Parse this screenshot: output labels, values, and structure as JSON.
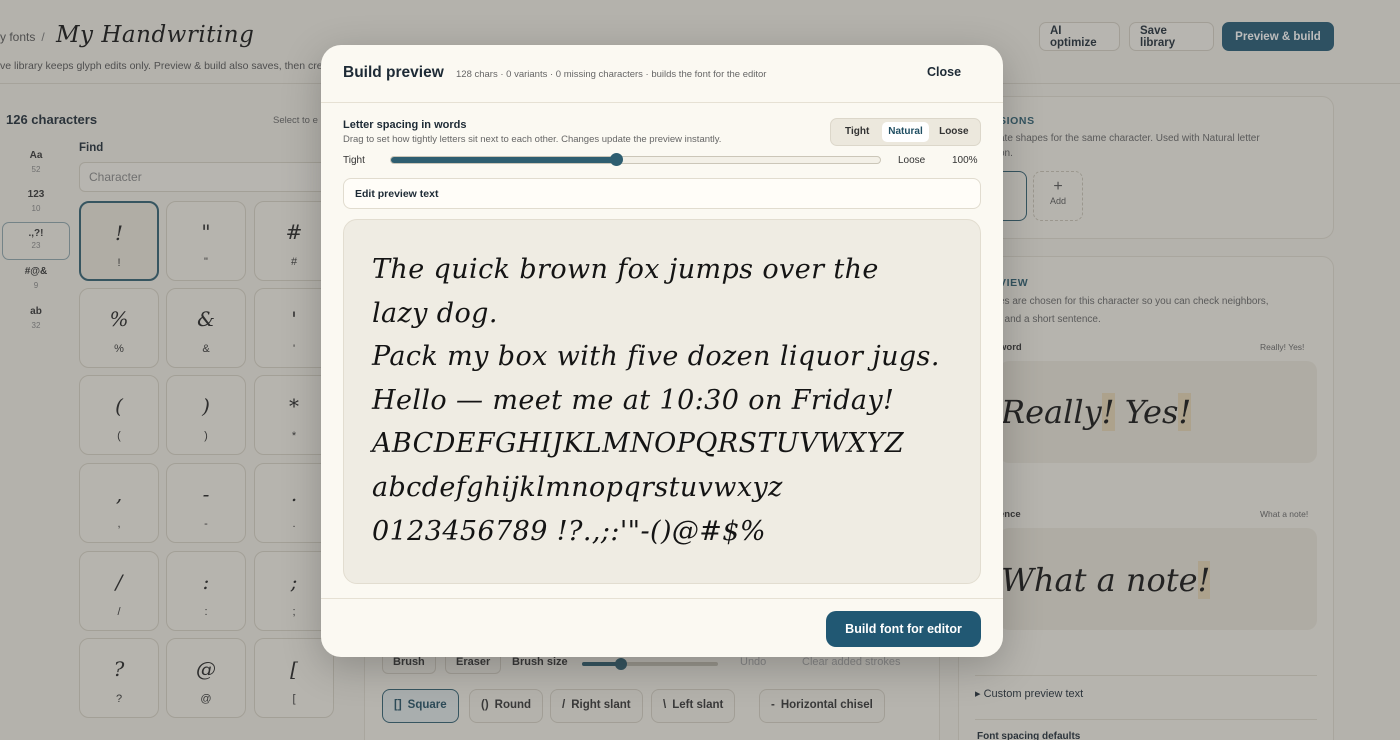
{
  "header": {
    "breadcrumb_parent": "y fonts",
    "breadcrumb_sep": "/",
    "font_name": "My Handwriting",
    "subline": "ve library keeps glyph edits only. Preview & build also saves, then cre",
    "ai_optimize": "AI optimize",
    "save_library": "Save library",
    "preview_build": "Preview & build"
  },
  "left": {
    "char_count": "126 characters",
    "select_hint": "Select to e",
    "find_label": "Find",
    "find_placeholder": "Character",
    "categories": [
      {
        "label": "Aa",
        "count": "52"
      },
      {
        "label": "123",
        "count": "10"
      },
      {
        "label": ".,?!",
        "count": "23"
      },
      {
        "label": "#@&",
        "count": "9"
      },
      {
        "label": "ab",
        "count": "32"
      }
    ],
    "tiles": [
      {
        "glyph": "!",
        "label": "!"
      },
      {
        "glyph": "\"",
        "label": "\""
      },
      {
        "glyph": "#",
        "label": "#"
      },
      {
        "glyph": "%",
        "label": "%"
      },
      {
        "glyph": "&",
        "label": "&"
      },
      {
        "glyph": "'",
        "label": "'"
      },
      {
        "glyph": "(",
        "label": "("
      },
      {
        "glyph": ")",
        "label": ")"
      },
      {
        "glyph": "*",
        "label": "*"
      },
      {
        "glyph": ",",
        "label": ","
      },
      {
        "glyph": "-",
        "label": "-"
      },
      {
        "glyph": ".",
        "label": "."
      },
      {
        "glyph": "/",
        "label": "/"
      },
      {
        "glyph": ":",
        "label": ":"
      },
      {
        "glyph": ";",
        "label": ";"
      },
      {
        "glyph": "?",
        "label": "?"
      },
      {
        "glyph": "@",
        "label": "@"
      },
      {
        "glyph": "[",
        "label": "["
      }
    ]
  },
  "right": {
    "variants_title": "SIONS",
    "variants_desc_1": "ate shapes for the same character. Used with Natural letter",
    "variants_desc_2": "on.",
    "add_label": "Add",
    "add_plus": "+",
    "preview_title": "VIEW",
    "preview_desc_1": "es are chosen for this character so you can check neighbors,",
    "preview_desc_2": ", and a short sentence.",
    "word_label": "word",
    "word_sample": "Really! Yes!",
    "word_before": "Really",
    "word_mark": "!",
    "word_mid": " Yes",
    "word_mark2": "!",
    "sentence_label": "ence",
    "sentence_sample": "What a note!",
    "sentence_before": "What a note",
    "sentence_mark": "!",
    "custom_preview": "▸ Custom preview text",
    "font_spacing": "Font spacing defaults"
  },
  "editor": {
    "brush": "Brush",
    "eraser": "Eraser",
    "brush_size": "Brush size",
    "brush_size_fraction": 0.3,
    "undo": "Undo",
    "clear": "Clear added strokes",
    "shapes": [
      {
        "icon": "[]",
        "label": "Square",
        "active": true
      },
      {
        "icon": "()",
        "label": "Round",
        "active": false
      },
      {
        "icon": "/",
        "label": "Right slant",
        "active": false
      },
      {
        "icon": "\\",
        "label": "Left slant",
        "active": false
      },
      {
        "icon": "-",
        "label": "Horizontal chisel",
        "active": false
      }
    ]
  },
  "modal": {
    "title": "Build preview",
    "meta": "128 chars · 0 variants · 0 missing characters · builds the font for the editor",
    "close": "Close",
    "spacing_label": "Letter spacing in words",
    "spacing_help": "Drag to set how tightly letters sit next to each other. Changes update the preview instantly.",
    "spacing_options": [
      "Tight",
      "Natural",
      "Loose"
    ],
    "spacing_selected": "Natural",
    "slider_left": "Tight",
    "slider_right": "Loose",
    "slider_value": "100%",
    "slider_fraction": 0.46,
    "edit_preview": "Edit preview text",
    "preview_lines": [
      "The quick brown fox jumps over the",
      "lazy dog.",
      "Pack my box with five dozen liquor jugs.",
      "Hello — meet me at 10:30 on Friday!",
      "ABCDEFGHIJKLMNOPQRSTUVWXYZ",
      "abcdefghijklmnopqrstuvwxyz",
      "0123456789 !?.,;:'\"-()@#$%"
    ],
    "build_button": "Build font for editor"
  },
  "colors": {
    "accent": "#215873",
    "background": "#f2efe6",
    "modal_bg": "#fbf9f2",
    "highlight": "#e8d7b4"
  }
}
